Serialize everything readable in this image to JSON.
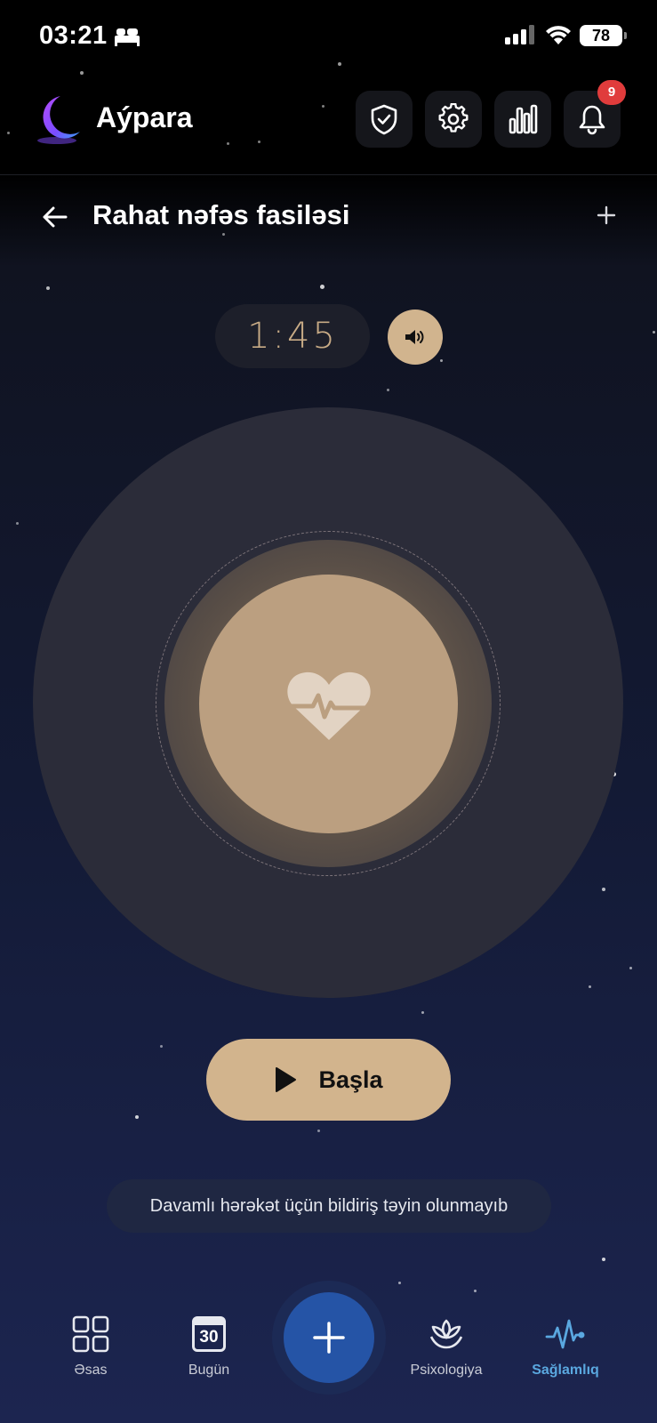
{
  "status_bar": {
    "time": "03:21",
    "battery": "78"
  },
  "header": {
    "app_name": "Aýpara",
    "notifications_count": "9"
  },
  "page": {
    "title": "Rahat nəfəs fasiləsi"
  },
  "timer": {
    "value": "1:45"
  },
  "start_button": {
    "label": "Başla"
  },
  "notice": {
    "text": "Davamlı hərəkət üçün bildiriş təyin olunmayıb"
  },
  "bottom_nav": {
    "items": [
      {
        "label": "Əsas",
        "icon": "grid-icon"
      },
      {
        "label": "Bugün",
        "icon": "calendar-icon",
        "day": "30"
      },
      {
        "label": "Psixologiya",
        "icon": "lotus-icon"
      },
      {
        "label": "Sağlamlıq",
        "icon": "pulse-icon",
        "active": true
      }
    ]
  },
  "colors": {
    "accent_gold": "#d2b48d",
    "core_circle": "#bb9f80",
    "active_nav": "#5aa8e0",
    "fab": "#2554a6",
    "badge": "#e03c3c"
  }
}
